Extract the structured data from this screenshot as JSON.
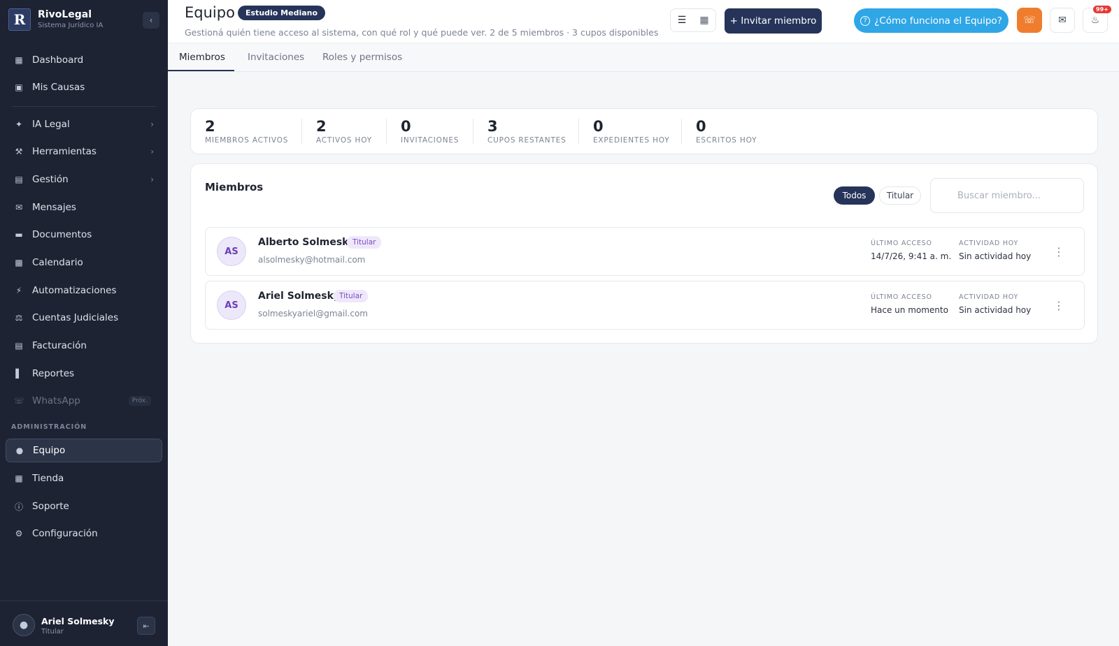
{
  "brand": {
    "logo": "R",
    "name": "RivoLegal",
    "subtitle": "Sistema Jurídico IA"
  },
  "sidebar": {
    "items": [
      {
        "label": "Dashboard",
        "icon": "dashboard-icon"
      },
      {
        "label": "Mis Causas",
        "icon": "briefcase-icon"
      },
      {
        "label": "IA Legal",
        "icon": "sparkle-icon",
        "chevron": true
      },
      {
        "label": "Herramientas",
        "icon": "wrench-icon",
        "chevron": true
      },
      {
        "label": "Gestión",
        "icon": "toolbox-icon",
        "chevron": true
      },
      {
        "label": "Mensajes",
        "icon": "mail-icon"
      },
      {
        "label": "Documentos",
        "icon": "folder-icon"
      },
      {
        "label": "Calendario",
        "icon": "calendar-icon"
      },
      {
        "label": "Automatizaciones",
        "icon": "bolt-icon"
      },
      {
        "label": "Cuentas Judiciales",
        "icon": "gavel-icon"
      },
      {
        "label": "Facturación",
        "icon": "receipt-icon"
      },
      {
        "label": "Reportes",
        "icon": "bar-chart-icon"
      },
      {
        "label": "WhatsApp",
        "icon": "whatsapp-icon",
        "badge": "Próx."
      }
    ],
    "admin_section_label": "ADMINISTRACIÓN",
    "admin_items": [
      {
        "label": "Equipo",
        "icon": "user-icon",
        "active": true
      },
      {
        "label": "Tienda",
        "icon": "store-icon"
      },
      {
        "label": "Soporte",
        "icon": "help-icon"
      },
      {
        "label": "Configuración",
        "icon": "gear-icon"
      }
    ],
    "user": {
      "name": "Ariel Solmesky",
      "role": "Titular"
    }
  },
  "header": {
    "title": "Equipo",
    "plan_badge": "Estudio Mediano",
    "subtitle": "Gestioná quién tiene acceso al sistema, con qué rol y qué puede ver. 2 de 5 miembros · 3 cupos disponibles",
    "invite_label": "+ Invitar miembro",
    "help_label": "¿Cómo funciona el Equipo?",
    "notifications_badge": "99+"
  },
  "tabs": [
    {
      "label": "Miembros",
      "active": true
    },
    {
      "label": "Invitaciones"
    },
    {
      "label": "Roles y permisos"
    }
  ],
  "stats": [
    {
      "value": "2",
      "label": "MIEMBROS ACTIVOS"
    },
    {
      "value": "2",
      "label": "ACTIVOS HOY"
    },
    {
      "value": "0",
      "label": "INVITACIONES"
    },
    {
      "value": "3",
      "label": "CUPOS RESTANTES"
    },
    {
      "value": "0",
      "label": "EXPEDIENTES HOY"
    },
    {
      "value": "0",
      "label": "ESCRITOS HOY"
    }
  ],
  "members_panel": {
    "title": "Miembros",
    "filters": [
      "Todos",
      "Titular"
    ],
    "search_placeholder": "Buscar miembro...",
    "last_access_label": "ÚLTIMO ACCESO",
    "activity_label": "ACTIVIDAD HOY",
    "members": [
      {
        "initials": "AS",
        "name": "Alberto Solmesky",
        "role": "Titular",
        "email": "alsolmesky@hotmail.com",
        "last_access": "14/7/26, 9:41 a. m.",
        "activity": "Sin actividad hoy"
      },
      {
        "initials": "AS",
        "name": "Ariel Solmesky",
        "role": "Titular",
        "email": "solmeskyariel@gmail.com",
        "last_access": "Hace un momento",
        "activity": "Sin actividad hoy"
      }
    ]
  },
  "colors": {
    "sidebar_bg": "#1d2333",
    "accent": "#26345a",
    "help_blue": "#2fa6e6",
    "support_orange": "#ef7d2d",
    "role_purple": "#7a4cc4"
  }
}
